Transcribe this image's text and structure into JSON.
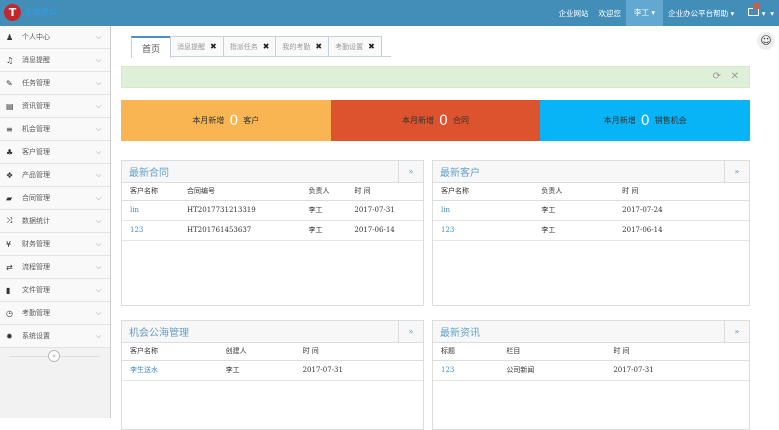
{
  "header": {
    "logo_letter": "T",
    "logo_text": "企业办公",
    "links": [
      "企业网站",
      "欢迎您"
    ],
    "user": "李工",
    "help": "企业办公平台帮助"
  },
  "sidebar": {
    "items": [
      {
        "label": "个人中心",
        "icon": "user-icon",
        "glyph": "♟"
      },
      {
        "label": "消息提醒",
        "icon": "bell-icon",
        "glyph": "♫"
      },
      {
        "label": "任务管理",
        "icon": "edit-icon",
        "glyph": "✎"
      },
      {
        "label": "资讯管理",
        "icon": "document-icon",
        "glyph": "▤"
      },
      {
        "label": "机会管理",
        "icon": "list-icon",
        "glyph": "≡"
      },
      {
        "label": "客户管理",
        "icon": "users-icon",
        "glyph": "♣"
      },
      {
        "label": "产品管理",
        "icon": "dropbox-icon",
        "glyph": "❖"
      },
      {
        "label": "合同管理",
        "icon": "folder-open-icon",
        "glyph": "▰"
      },
      {
        "label": "数据统计",
        "icon": "random-icon",
        "glyph": "⤨"
      },
      {
        "label": "财务管理",
        "icon": "yen-icon",
        "glyph": "¥"
      },
      {
        "label": "流程管理",
        "icon": "retweet-icon",
        "glyph": "⇄"
      },
      {
        "label": "文件管理",
        "icon": "file-icon",
        "glyph": "▮"
      },
      {
        "label": "考勤管理",
        "icon": "clock-icon",
        "glyph": "◷"
      },
      {
        "label": "系统设置",
        "icon": "cog-icon",
        "glyph": "✹"
      }
    ],
    "collapse": "«"
  },
  "tabs": [
    {
      "label": "首页",
      "active": true
    },
    {
      "label": "消息提醒"
    },
    {
      "label": "指派任务"
    },
    {
      "label": "我的考勤"
    },
    {
      "label": "考勤设置"
    }
  ],
  "stats": [
    {
      "prefix": "本月新增",
      "value": "0",
      "suffix": "客户",
      "color": "#f9b551"
    },
    {
      "prefix": "本月新增",
      "value": "0",
      "suffix": "合同",
      "color": "#dc532e"
    },
    {
      "prefix": "本月新增",
      "value": "0",
      "suffix": "销售机会",
      "color": "#08b4f6"
    }
  ],
  "panels": {
    "contracts": {
      "title": "最新合同",
      "more": "»",
      "headers": [
        "客户名称",
        "合同编号",
        "负责人",
        "时 间"
      ],
      "rows": [
        [
          "lin",
          "HT2017731213319",
          "李工",
          "2017-07-31"
        ],
        [
          "123",
          "HT201761453637",
          "李工",
          "2017-06-14"
        ]
      ]
    },
    "customers": {
      "title": "最新客户",
      "more": "»",
      "headers": [
        "客户名称",
        "负责人",
        "时 间"
      ],
      "rows": [
        [
          "lin",
          "李工",
          "2017-07-24"
        ],
        [
          "123",
          "李工",
          "2017-06-14"
        ]
      ]
    },
    "opportunities": {
      "title": "机会公海管理",
      "more": "»",
      "headers": [
        "客户名称",
        "创建人",
        "时 间"
      ],
      "rows": [
        [
          "李生送水",
          "李工",
          "2017-07-31"
        ]
      ]
    },
    "news": {
      "title": "最新资讯",
      "more": "»",
      "headers": [
        "标题",
        "栏目",
        "时 间"
      ],
      "rows": [
        [
          "123",
          "公司新闻",
          "2017-07-31"
        ]
      ]
    }
  }
}
